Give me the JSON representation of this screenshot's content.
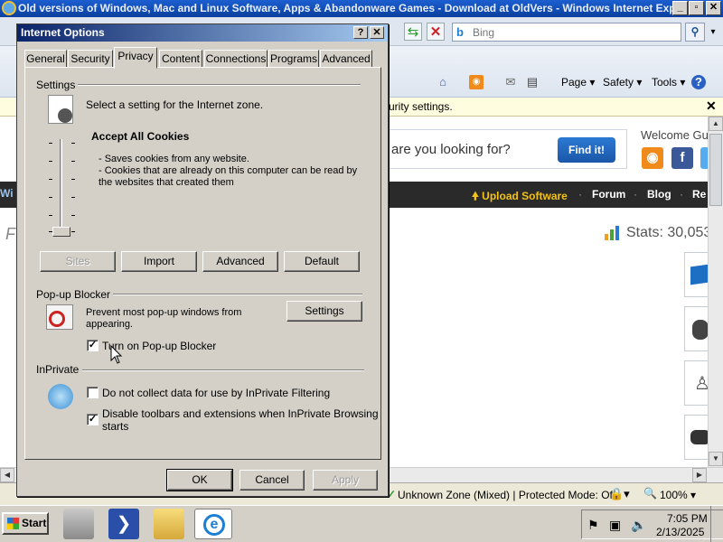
{
  "browser": {
    "window_title": "Old versions of Windows, Mac and Linux Software, Apps & Abandonware Games - Download at OldVers - Windows Internet Explo",
    "search_engine": "Bing",
    "search_placeholder": "Bing",
    "command_bar": {
      "page": "Page",
      "safety": "Safety",
      "tools": "Tools"
    },
    "info_bar": "urity settings.",
    "status": {
      "zone": "Unknown Zone (Mixed) | Protected Mode: Off",
      "zoom": "100%"
    }
  },
  "web_page": {
    "search_prompt": "are you looking for?",
    "find_button": "Find it!",
    "welcome": "Welcome Gu",
    "nav_partial": "Wi",
    "nav": {
      "upload": "Upload Software",
      "forum": "Forum",
      "blog": "Blog",
      "more": "Re"
    },
    "left_partial": "F",
    "stats": "Stats: 30,053"
  },
  "dialog": {
    "title": "Internet Options",
    "tabs": [
      {
        "label": "General",
        "active": false
      },
      {
        "label": "Security",
        "active": false
      },
      {
        "label": "Privacy",
        "active": true
      },
      {
        "label": "Content",
        "active": false
      },
      {
        "label": "Connections",
        "active": false
      },
      {
        "label": "Programs",
        "active": false
      },
      {
        "label": "Advanced",
        "active": false
      }
    ],
    "settings": {
      "group_label": "Settings",
      "intro": "Select a setting for the Internet zone.",
      "level_title": "Accept All Cookies",
      "line1": "- Saves cookies from any website.",
      "line2": "- Cookies that are already on this computer can be read by",
      "line3": "the websites that created them",
      "slider_level": 0,
      "buttons": {
        "sites": "Sites",
        "import": "Import",
        "advanced": "Advanced",
        "default": "Default"
      }
    },
    "popup_blocker": {
      "group_label": "Pop-up Blocker",
      "description_line1": "Prevent most pop-up windows from",
      "description_line2": "appearing.",
      "settings_button": "Settings",
      "turn_on_label": "Turn on Pop-up Blocker",
      "turn_on_checked": true
    },
    "inprivate": {
      "group_label": "InPrivate",
      "no_collect_label": "Do not collect data for use by InPrivate Filtering",
      "no_collect_checked": false,
      "disable_toolbars_line1": "Disable toolbars and extensions when InPrivate Browsing",
      "disable_toolbars_line2": "starts",
      "disable_toolbars_checked": true
    },
    "footer": {
      "ok": "OK",
      "cancel": "Cancel",
      "apply": "Apply"
    }
  },
  "taskbar": {
    "start": "Start",
    "time": "7:05 PM",
    "date": "2/13/2025"
  },
  "colors": {
    "title_gradient_start": "#0a246a",
    "dialog_face": "#d4d0c8",
    "find_button": "#2c7ad4",
    "upload_link": "#f2c21b"
  }
}
